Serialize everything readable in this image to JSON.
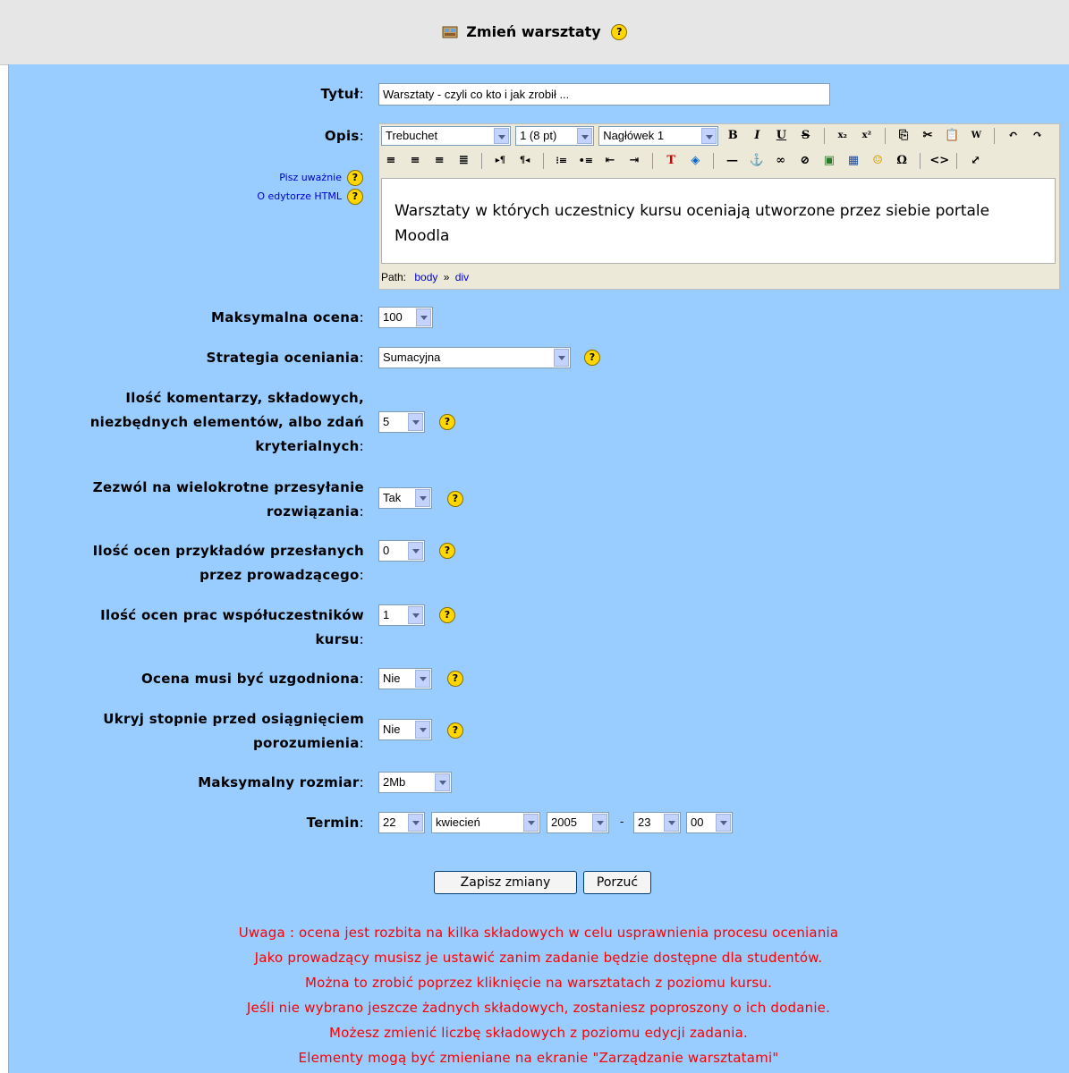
{
  "header": {
    "title": "Zmień warsztaty",
    "help_glyph": "?"
  },
  "form": {
    "title_label": "Tytuł",
    "title_value": "Warsztaty - czyli co kto i jak zrobił ...",
    "desc_label": "Opis",
    "side_links": [
      "Pisz uważnie",
      "O edytorze HTML"
    ],
    "editor": {
      "font": "Trebuchet",
      "size": "1 (8 pt)",
      "format": "Nagłówek 1",
      "content": "Warsztaty w których uczestnicy kursu oceniają utworzone przez siebie portale Moodla",
      "path_label": "Path:",
      "path_items": [
        "body",
        "div"
      ],
      "path_sep": "»"
    },
    "fields": [
      {
        "label": "Maksymalna ocena",
        "value": "100",
        "help": false
      },
      {
        "label": "Strategia oceniania",
        "value": "Sumacyjna",
        "help": true
      },
      {
        "label": "Ilość komentarzy, składowych, niezbędnych elementów, albo zdań kryterialnych",
        "value": "5",
        "help": true
      },
      {
        "label": "Zezwól na wielokrotne przesyłanie rozwiązania",
        "value": "Tak",
        "help": true
      },
      {
        "label": "Ilość ocen przykładów przesłanych przez prowadzącego",
        "value": "0",
        "help": true
      },
      {
        "label": "Ilość ocen prac współuczestników kursu",
        "value": "1",
        "help": true
      },
      {
        "label": "Ocena musi być uzgodniona",
        "value": "Nie",
        "help": true
      },
      {
        "label": "Ukryj stopnie przed osiągnięciem porozumienia",
        "value": "Nie",
        "help": true
      },
      {
        "label": "Maksymalny rozmiar",
        "value": "2Mb",
        "help": false
      }
    ],
    "deadline": {
      "label": "Termin",
      "day": "22",
      "month": "kwiecień",
      "year": "2005",
      "dash": "-",
      "hour": "23",
      "minute": "00"
    }
  },
  "buttons": {
    "save": "Zapisz zmiany",
    "cancel": "Porzuć"
  },
  "notes": [
    "Uwaga : ocena jest rozbita na kilka składowych w celu usprawnienia procesu oceniania",
    "Jako prowadzący musisz je ustawić zanim zadanie będzie dostępne dla studentów.",
    "Można to zrobić poprzez kliknięcie na warsztatach z poziomu kursu.",
    "Jeśli nie wybrano jeszcze żadnych składowych, zostaniesz poproszony o ich dodanie.",
    "Możesz zmienić liczbę składowych z poziomu edycji zadania.",
    "Elementy mogą być zmieniane na ekranie \"Zarządzanie warsztatami\""
  ]
}
